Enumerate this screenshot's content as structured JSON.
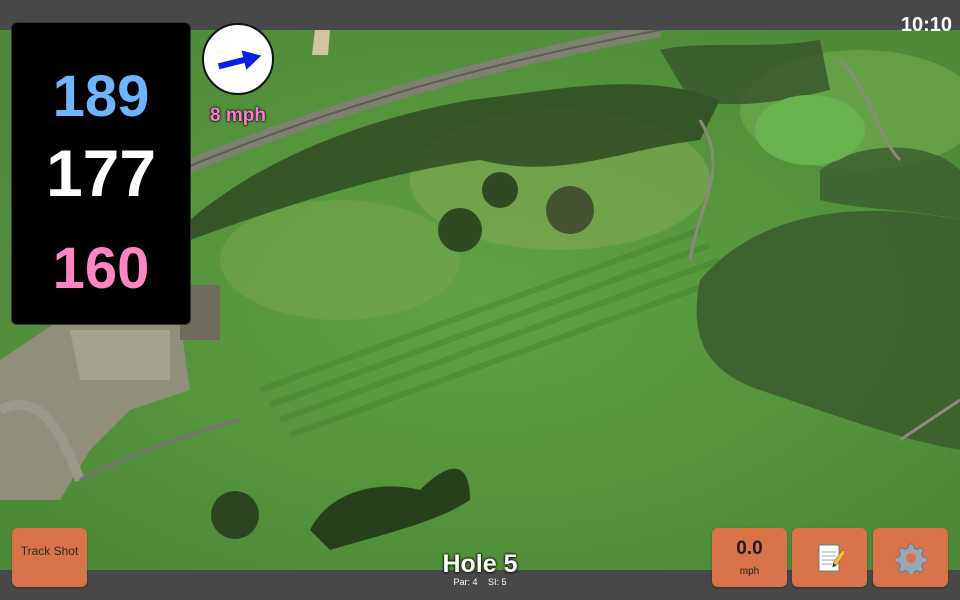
{
  "status_bar": {
    "time": "10:10"
  },
  "distances": {
    "back": "189",
    "middle": "177",
    "front": "160"
  },
  "wind": {
    "speed_label": "8 mph",
    "arrow_icon": "arrow-right-icon"
  },
  "hole": {
    "title": "Hole 5",
    "par": "Par: 4",
    "stroke_index": "SI: 5"
  },
  "buttons": {
    "track_shot": "Track Shot",
    "speed_value": "0.0",
    "speed_unit": "mph",
    "notes_icon": "memo-icon",
    "settings_icon": "gear-icon"
  },
  "colors": {
    "button_bg": "#d9744a",
    "back_distance": "#6fb4ff",
    "middle_distance": "#ffffff",
    "front_distance": "#ff84c2",
    "wind_text": "#ff7ad0"
  }
}
